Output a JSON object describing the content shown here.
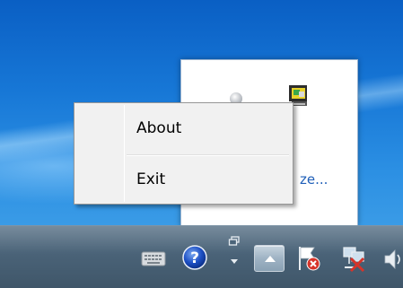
{
  "context_menu": {
    "items": [
      {
        "label": "About"
      },
      {
        "label": "Exit"
      }
    ]
  },
  "tray_popup": {
    "customize_link": "ze..."
  },
  "taskbar": {
    "tray_icons": [
      "keyboard-icon",
      "help-icon",
      "restore-icon",
      "show-hidden-icons-button",
      "action-center-flag-icon",
      "network-icon",
      "speaker-icon"
    ]
  },
  "colors": {
    "desktop_top": "#0a5fc4",
    "desktop_bottom": "#3a9be6",
    "taskbar": "#4b6479",
    "menu_bg": "#f1f1f1",
    "link": "#1f5fb8"
  }
}
